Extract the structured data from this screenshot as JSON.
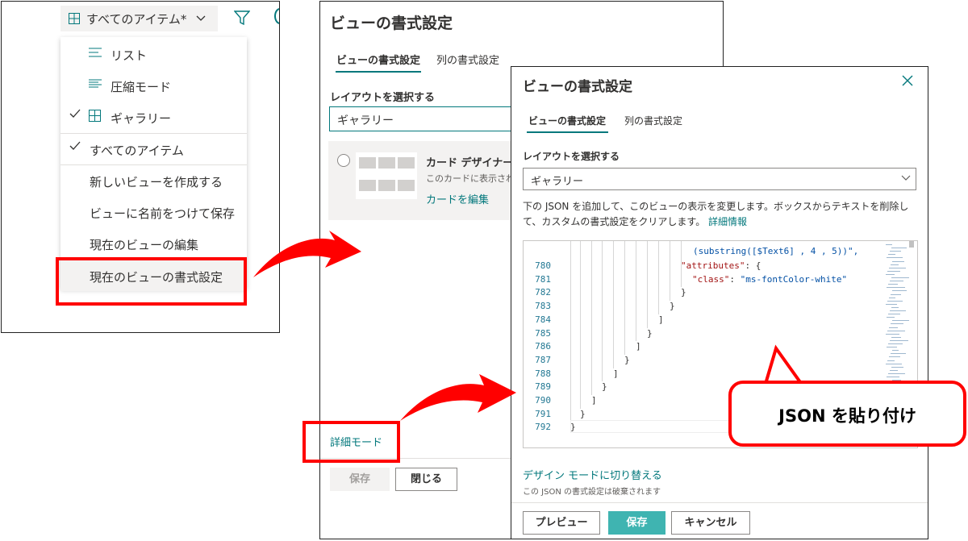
{
  "menu": {
    "view_button_label": "すべてのアイテム*",
    "items": [
      {
        "label": "リスト",
        "icon": "list-icon",
        "checked": false
      },
      {
        "label": "圧縮モード",
        "icon": "compact-list-icon",
        "checked": false
      },
      {
        "label": "ギャラリー",
        "icon": "gallery-grid-icon",
        "checked": true
      },
      {
        "label": "すべてのアイテム",
        "checked": true
      },
      {
        "label": "新しいビューを作成する"
      },
      {
        "label": "ビューに名前をつけて保存"
      },
      {
        "label": "現在のビューの編集"
      },
      {
        "label": "現在のビューの書式設定"
      }
    ]
  },
  "panel_back": {
    "title": "ビューの書式設定",
    "tabs": [
      "ビューの書式設定",
      "列の書式設定"
    ],
    "layout_label": "レイアウトを選択する",
    "layout_value": "ギャラリー",
    "card_title": "カード デザイナー",
    "card_desc": "このカードに表示され",
    "card_link": "カードを編集",
    "advanced_mode": "詳細モード",
    "save": "保存",
    "close": "閉じる"
  },
  "panel_front": {
    "title": "ビューの書式設定",
    "tabs": [
      "ビューの書式設定",
      "列の書式設定"
    ],
    "layout_label": "レイアウトを選択する",
    "layout_value": "ギャラリー",
    "description": "下の JSON を追加して、このビューの表示を変更します。ボックスからテキストを削除して、カスタムの書式設定をクリアします。",
    "more_info": "詳細情報",
    "code_partial_line": "(substring([$Text6] , 4 , 5))\",",
    "code_lines": [
      {
        "num": "780",
        "text": "\"attributes\": {"
      },
      {
        "num": "781",
        "text": "\"class\": \"ms-fontColor-white\""
      },
      {
        "num": "782",
        "text": "}"
      },
      {
        "num": "783",
        "text": "}"
      },
      {
        "num": "784",
        "text": "]"
      },
      {
        "num": "785",
        "text": "}"
      },
      {
        "num": "786",
        "text": "]"
      },
      {
        "num": "787",
        "text": "}"
      },
      {
        "num": "788",
        "text": "]"
      },
      {
        "num": "789",
        "text": "}"
      },
      {
        "num": "790",
        "text": "]"
      },
      {
        "num": "791",
        "text": "}"
      },
      {
        "num": "792",
        "text": "}"
      }
    ],
    "design_mode_link": "デザイン モードに切り替える",
    "warning": "この JSON の書式設定は破棄されます",
    "preview": "プレビュー",
    "save": "保存",
    "cancel": "キャンセル"
  },
  "callout": {
    "text": "JSON を貼り付け"
  },
  "colors": {
    "accent": "#03787c",
    "highlight": "#ff0000",
    "primary_button": "#3fb4b1"
  }
}
